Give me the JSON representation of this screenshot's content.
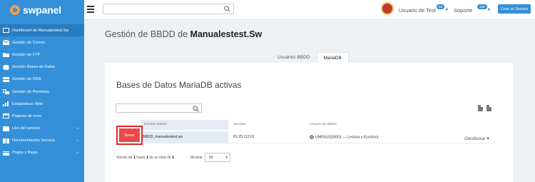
{
  "brand": {
    "name": "swpanel"
  },
  "sidebar": {
    "items": [
      {
        "label": "Dashboard de Manualestest.Sw",
        "icon": "dashboard-icon"
      },
      {
        "label": "Gestión de Correo",
        "icon": "mail-icon"
      },
      {
        "label": "Gestión de FTP",
        "icon": "folder-icon"
      },
      {
        "label": "Gestión Bases de Datos",
        "icon": "database-icon"
      },
      {
        "label": "Gestión de DNS",
        "icon": "dns-icon"
      },
      {
        "label": "Gestión de Permisos",
        "icon": "permissions-icon"
      },
      {
        "label": "Estadísticas Web",
        "icon": "stats-icon"
      },
      {
        "label": "Páginas de error",
        "icon": "error-pages-icon"
      },
      {
        "label": "Uso del servicio",
        "icon": "usage-icon"
      },
      {
        "label": "Documentación Servicio",
        "icon": "docs-icon"
      },
      {
        "label": "Pagos y Bajas",
        "icon": "payments-icon"
      }
    ]
  },
  "topbar": {
    "search_placeholder": "",
    "user_label": "Usuario de Test",
    "user_badge": "65",
    "support_label": "Soporte",
    "support_badge": "430",
    "create_button": "Crear un Servicio"
  },
  "page": {
    "title_prefix": "Gestión de BBDD de",
    "title_domain": "Manualestest.Sw",
    "tabs": [
      {
        "label": "Usuarios BBDD"
      },
      {
        "label": "MariaDB"
      }
    ],
    "card_title": "Bases de Datos MariaDB activas"
  },
  "table": {
    "headers": {
      "name": "Nombre BBDD",
      "server": "Servidor",
      "user": "Usuario de BBDD"
    },
    "rows": [
      {
        "delete_label": "Borrar",
        "name": "BBDD_manualestest.sw",
        "server": "81.25.112.61",
        "user": "UM0SUSD0001",
        "perm": "— Lectura y Escritura",
        "manage_label": "Gestionar"
      }
    ]
  },
  "footer": {
    "text_prefix": "Viendo de",
    "from": "1",
    "text_mid1": "hasta",
    "to": "1",
    "text_mid2": "de un total de",
    "total": "1",
    "show_label": "Mostrar",
    "page_size": "50"
  },
  "colors": {
    "sidebar": "#3390d8",
    "accent": "#3390d8",
    "danger": "#e84a4a",
    "highlight": "#e5252a"
  }
}
